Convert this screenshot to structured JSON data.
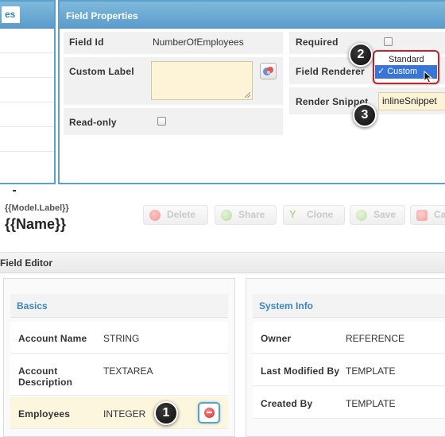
{
  "left_panel": {
    "title": "es"
  },
  "field_properties": {
    "title": "Field Properties",
    "field_id_label": "Field Id",
    "field_id_value": "NumberOfEmployees",
    "custom_label_label": "Custom Label",
    "custom_label_value": "",
    "read_only_label": "Read-only",
    "required_label": "Required",
    "field_renderer_label": "Field Renderer",
    "render_snippet_label": "Render Snippet",
    "render_snippet_value": "inlineSnippet",
    "renderer_options": [
      "Standard",
      "Custom"
    ],
    "renderer_selected": "Custom",
    "checkmark": "✓"
  },
  "steps": [
    "1",
    "2",
    "3"
  ],
  "record": {
    "model_label": "{{Model.Label}}",
    "name": "{{Name}}"
  },
  "toolbar": {
    "delete_label": "Delete",
    "share_label": "Share",
    "clone_label": "Clone",
    "save_label": "Save",
    "cancel_label": "Ca"
  },
  "field_editor": {
    "title": "Field Editor"
  },
  "basics": {
    "title": "Basics",
    "rows": [
      {
        "label": "Account Name",
        "type": "STRING"
      },
      {
        "label": "Account Description",
        "type": "TEXTAREA"
      },
      {
        "label": "Employees",
        "type": "INTEGER"
      }
    ]
  },
  "system_info": {
    "title": "System Info",
    "rows": [
      {
        "label": "Owner",
        "type": "REFERENCE"
      },
      {
        "label": "Last Modified By",
        "type": "TEMPLATE"
      },
      {
        "label": "Created By",
        "type": "TEMPLATE"
      }
    ]
  },
  "colors": {
    "panel_blue": "#5ba1cc",
    "highlight_red": "#c0262b",
    "selection_blue": "#3875d7",
    "input_yellow": "#fdf3d6"
  }
}
